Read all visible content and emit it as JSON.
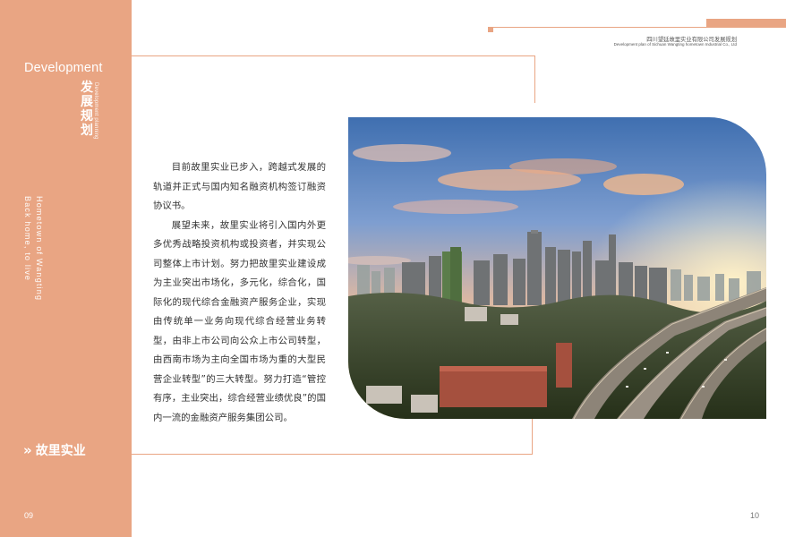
{
  "sidebar": {
    "title_en": "Development",
    "title_cn": "发展规划",
    "subtitle_vertical": "Development planning",
    "vertical_line1": "Hometown of Wangting",
    "vertical_line2": "Back home, to live",
    "section_label": "故里实业",
    "section_icon": "double-chevron-right-icon",
    "page_number": "09"
  },
  "header": {
    "company_cn": "四川望廷故里实业有限公司发展规划",
    "company_en": "Development plan of Sichuan Wangting hometown Industrial Co., Ltd"
  },
  "body": {
    "paragraphs": [
      "目前故里实业已步入，跨越式发展的轨道并正式与国内知名融资机构签订融资协议书。",
      "展望未来，故里实业将引入国内外更多优秀战略投资机构或投资者，并实现公司整体上市计划。努力把故里实业建设成为主业突出市场化，多元化，综合化，国际化的现代综合金融资产服务企业，实现由传统单一业务向现代综合经营业务转型，由非上市公司向公众上市公司转型，由西南市场为主向全国市场为重的大型民营企业转型”的三大转型。努力打造“管控有序，主业突出，综合经营业绩优良”的国内一流的金融资产服务集团公司。"
    ]
  },
  "image": {
    "description_icon": "city-skyline-photo"
  },
  "footer": {
    "page_number_right": "10"
  },
  "colors": {
    "accent": "#e9a583",
    "text": "#333333"
  }
}
